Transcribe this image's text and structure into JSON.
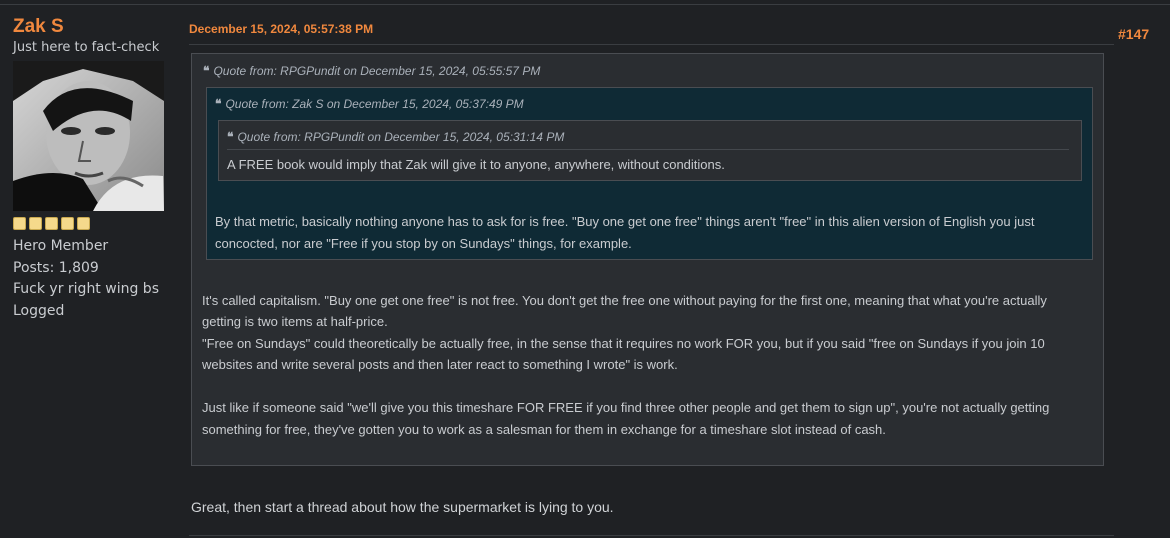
{
  "poster": {
    "name": "Zak S",
    "custom_title": "Just here to fact-check",
    "rank_stars": 5,
    "rank": "Hero Member",
    "posts": "Posts: 1,809",
    "signature_line": "Fuck yr right wing bs",
    "status": "Logged"
  },
  "post": {
    "date": "December 15, 2024, 05:57:38 PM",
    "number": "#147",
    "reply": "Great, then start a thread about how the supermarket is lying to you."
  },
  "quote1": {
    "header": "Quote from: RPGPundit on December 15, 2024, 05:55:57 PM",
    "lines": [
      "It's called capitalism. \"Buy one get one free\" is not free. You don't get the free one without paying for the first one, meaning that what you're actually",
      "getting is two items at half-price.",
      "\"Free on Sundays\" could theoretically be actually free, in the sense that it requires no work FOR you, but if you said \"free on Sundays if you join 10",
      "websites and write several posts and then later react to something I wrote\" is work.",
      "Just like if someone said \"we'll give you this timeshare FOR FREE if you find three other people and get them to sign up\", you're not actually getting",
      "something for free, they've gotten you to work as a salesman for them in exchange for a timeshare slot instead of cash."
    ]
  },
  "quote2": {
    "header": "Quote from: Zak S on December 15, 2024, 05:37:49 PM",
    "lines": [
      "By that metric, basically nothing anyone has to ask for is free. \"Buy one get one free\" things aren't \"free\" in this alien version of English you just",
      "concocted, nor are \"Free if you stop by on Sundays\" things, for example."
    ]
  },
  "quote3": {
    "header": "Quote from: RPGPundit on December 15, 2024, 05:31:14 PM",
    "text": "A FREE book would imply that Zak will give it to anyone, anywhere, without conditions."
  },
  "icons": {
    "quote": "quote-icon"
  },
  "colors": {
    "accent": "#f0883e",
    "background": "#1f2124",
    "quote_box": "#2a2d31",
    "nested_quote": "#0f2a35"
  }
}
